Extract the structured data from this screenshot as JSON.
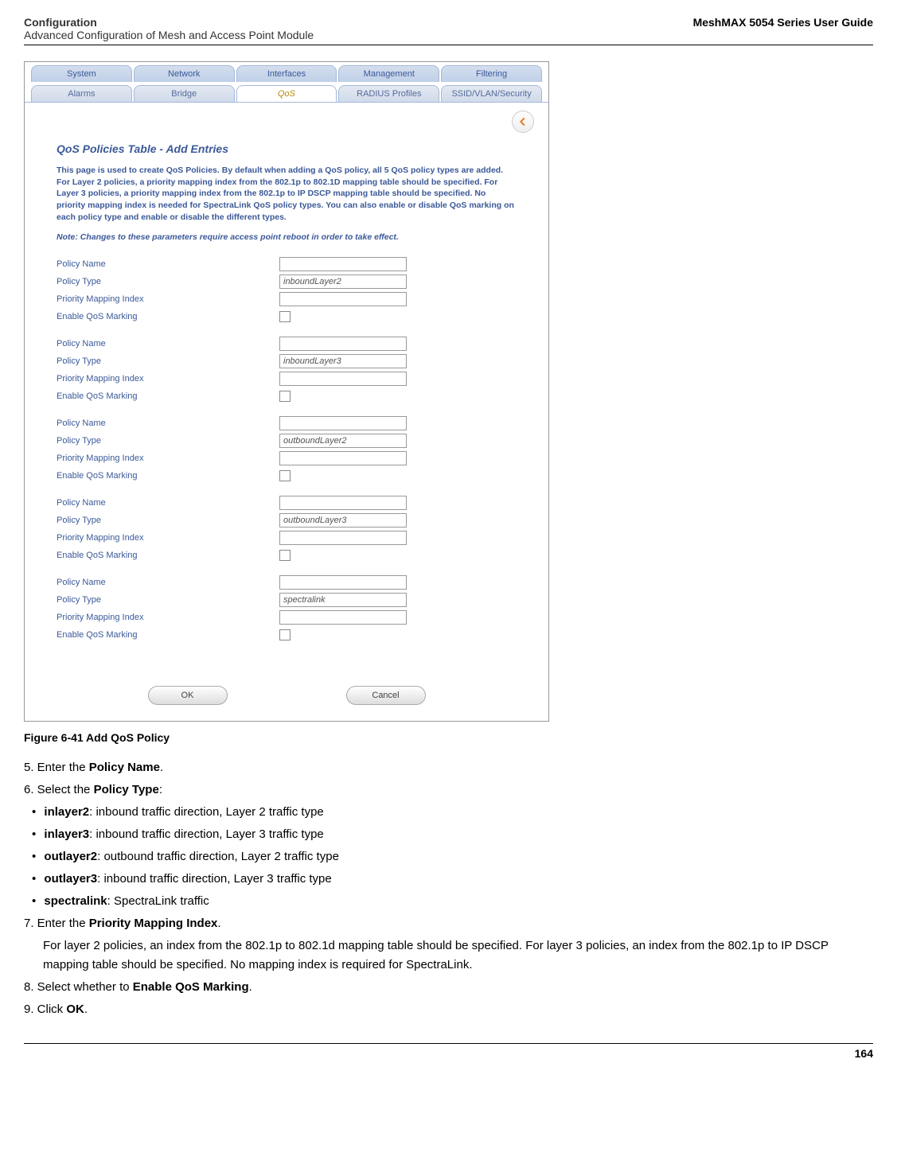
{
  "header": {
    "left_line1": "Configuration",
    "left_line2": "Advanced Configuration of Mesh and Access Point Module",
    "right": "MeshMAX 5054 Series User Guide"
  },
  "screenshot": {
    "top_tabs": [
      "System",
      "Network",
      "Interfaces",
      "Management",
      "Filtering"
    ],
    "sub_tabs": [
      "Alarms",
      "Bridge",
      "QoS",
      "RADIUS Profiles",
      "SSID/VLAN/Security"
    ],
    "active_sub_tab_index": 2,
    "title": "QoS Policies Table - Add Entries",
    "description": "This page is used to create QoS Policies. By default when adding a QoS policy, all 5 QoS policy types are added. For Layer 2 policies, a priority mapping index from the 802.1p to 802.1D mapping table should be specified. For Layer 3 policies, a priority mapping index from the 802.1p to IP DSCP mapping table should be specified. No priority mapping index is needed for SpectraLink QoS policy types. You can also enable or disable QoS marking on each policy type and enable or disable the different types.",
    "note": "Note: Changes to these parameters require access point reboot in order to take effect.",
    "labels": {
      "policy_name": "Policy Name",
      "policy_type": "Policy Type",
      "priority_mapping_index": "Priority Mapping Index",
      "enable_qos_marking": "Enable QoS Marking"
    },
    "groups": [
      {
        "policy_type_value": "inboundLayer2"
      },
      {
        "policy_type_value": "inboundLayer3"
      },
      {
        "policy_type_value": "outboundLayer2"
      },
      {
        "policy_type_value": "outboundLayer3"
      },
      {
        "policy_type_value": "spectralink"
      }
    ],
    "buttons": {
      "ok": "OK",
      "cancel": "Cancel"
    }
  },
  "figure_caption": "Figure 6-41 Add QoS Policy",
  "steps": {
    "s5_prefix": "5. Enter the ",
    "s5_bold": "Policy Name",
    "s5_suffix": ".",
    "s6_prefix": "6. Select the ",
    "s6_bold": "Policy Type",
    "s6_suffix": ":",
    "bullets": [
      {
        "bold": "inlayer2",
        "rest": ": inbound traffic direction, Layer 2 traffic type"
      },
      {
        "bold": "inlayer3",
        "rest": ": inbound traffic direction, Layer 3 traffic type"
      },
      {
        "bold": "outlayer2",
        "rest": ": outbound traffic direction, Layer 2 traffic type"
      },
      {
        "bold": "outlayer3",
        "rest": ": inbound traffic direction, Layer 3 traffic type"
      },
      {
        "bold": "spectralink",
        "rest": ": SpectraLink traffic"
      }
    ],
    "s7_prefix": "7. Enter the ",
    "s7_bold": "Priority Mapping Index",
    "s7_suffix": ".",
    "s7_detail": "For layer 2 policies, an index from the 802.1p to 802.1d mapping table should be specified. For layer 3 policies, an index from the 802.1p to IP DSCP mapping table should be specified. No mapping index is required for SpectraLink.",
    "s8_prefix": "8. Select whether to ",
    "s8_bold": "Enable QoS Marking",
    "s8_suffix": ".",
    "s9_prefix": "9. Click ",
    "s9_bold": "OK",
    "s9_suffix": "."
  },
  "footer": {
    "page": "164"
  }
}
